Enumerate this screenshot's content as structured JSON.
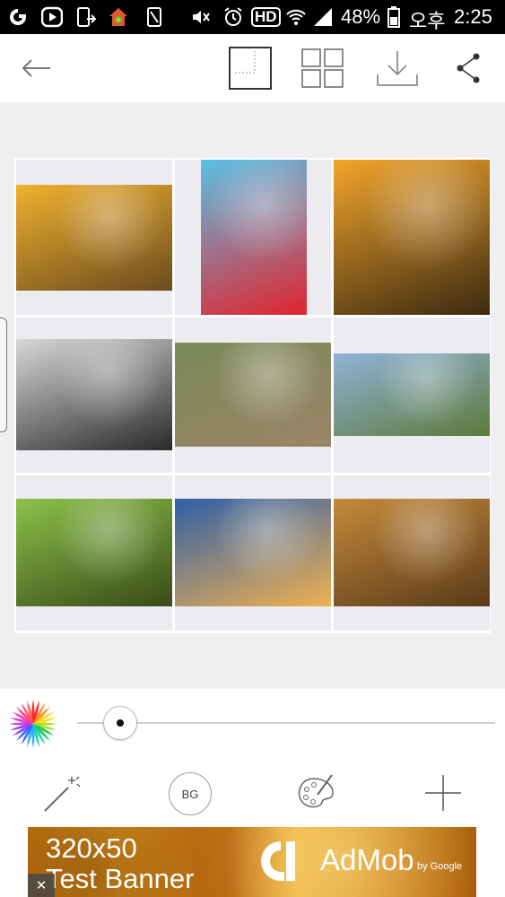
{
  "status_bar": {
    "battery": "48%",
    "korean_ampm": "오후",
    "time": "2:25",
    "hd_label": "HD"
  },
  "toolbar": {
    "back_icon": "arrow-left-icon",
    "layout_single_icon": "single-frame-icon",
    "layout_grid_icon": "grid-layout-icon",
    "download_icon": "download-icon",
    "share_icon": "share-icon"
  },
  "collage": {
    "rows": 3,
    "cols": 3,
    "photos": [
      {
        "subject": "girl in golden field at sunset",
        "colors": [
          "#f1b12e",
          "#6b4b1f"
        ]
      },
      {
        "subject": "woman with red hat drinking cola",
        "colors": [
          "#5ac0e6",
          "#e2242d"
        ]
      },
      {
        "subject": "two bottles toast at sunset",
        "colors": [
          "#f3a52a",
          "#3c2a12"
        ]
      },
      {
        "subject": "black and white child with flower crown",
        "colors": [
          "#d8d8d8",
          "#2a2a2a"
        ]
      },
      {
        "subject": "two children on stone path",
        "colors": [
          "#7a8a5a",
          "#9b8466"
        ]
      },
      {
        "subject": "hiker overlooking fjord",
        "colors": [
          "#8fb3d9",
          "#5d7a3a"
        ]
      },
      {
        "subject": "woman posing on motorcycle",
        "colors": [
          "#8bc24a",
          "#3a4a18"
        ]
      },
      {
        "subject": "two women walking on railway",
        "colors": [
          "#2e5fa8",
          "#f0b050"
        ]
      },
      {
        "subject": "blonde girl portrait in sunlight",
        "colors": [
          "#c58a3a",
          "#5a3a1a"
        ]
      }
    ]
  },
  "slider": {
    "value_fraction": 0.1
  },
  "bottom_tools": {
    "magic_icon": "magic-wand-icon",
    "bg_label": "BG",
    "palette_icon": "palette-icon",
    "add_icon": "plus-icon"
  },
  "ad": {
    "size_text": "320x50",
    "banner_text": "Test Banner",
    "brand": "AdMob",
    "by_text": "by Google",
    "close_glyph": "✕"
  }
}
